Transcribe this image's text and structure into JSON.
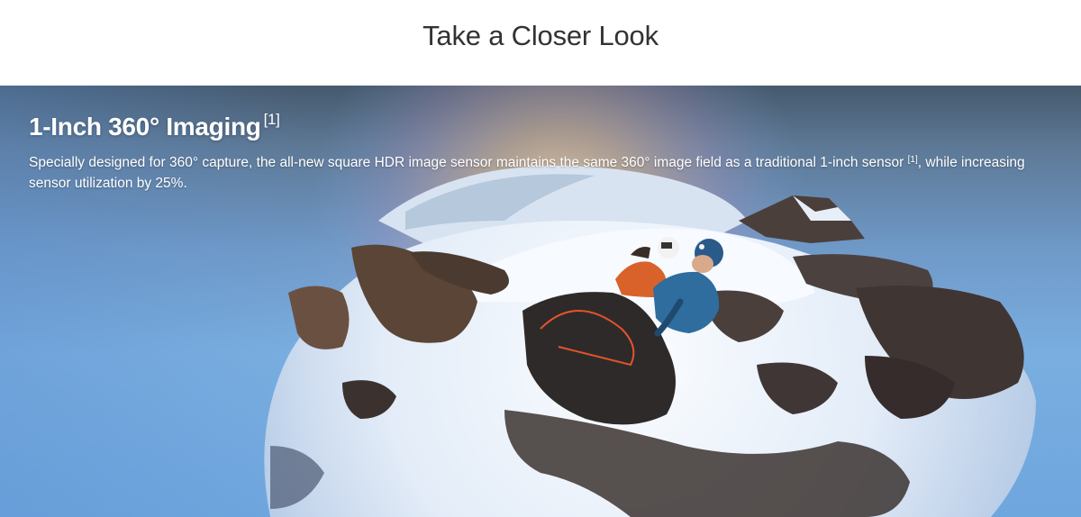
{
  "section": {
    "title": "Take a Closer Look"
  },
  "feature": {
    "title": "1-Inch 360° Imaging",
    "title_footnote": "[1]",
    "description_part1": "Specially designed for 360° capture, the all-new square HDR image sensor maintains the same 360° image field as a traditional 1-inch sensor ",
    "description_footnote": "[1]",
    "description_part2": ", while increasing sensor utilization by 25%."
  },
  "hero_image": {
    "subject": "tiny-planet view of two climbers in helmets on a snowy mountain peak",
    "colors": {
      "sky_top": "#46596d",
      "sky_bottom": "#6ea6de",
      "snow": "#eef3fb",
      "rock": "#3a2f2a",
      "sun_glow": "#f3c27a",
      "jacket_orange": "#d9622a",
      "jacket_blue": "#2f6d9e"
    }
  }
}
